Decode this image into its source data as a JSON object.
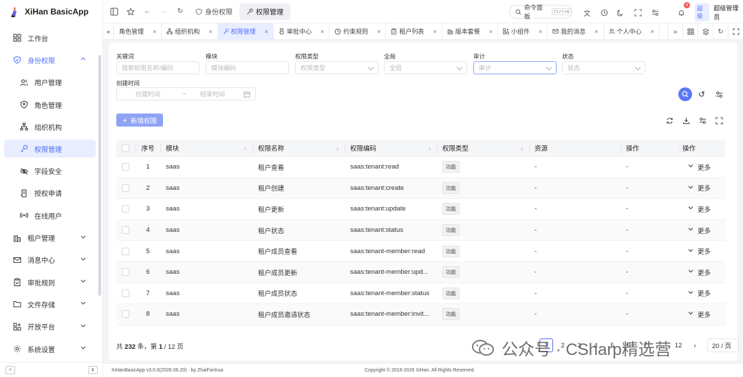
{
  "app": {
    "title": "XiHan BasicApp"
  },
  "sidebar": {
    "items": [
      {
        "label": "工作台",
        "icon": "dashboard-icon"
      },
      {
        "label": "身份权限",
        "icon": "shield-icon",
        "open": true
      },
      {
        "label": "用户管理",
        "icon": "users-icon",
        "sub": true
      },
      {
        "label": "角色管理",
        "icon": "role-shield-icon",
        "sub": true
      },
      {
        "label": "组织机构",
        "icon": "org-tree-icon",
        "sub": true
      },
      {
        "label": "权限管理",
        "icon": "key-icon",
        "sub": true,
        "active": true
      },
      {
        "label": "字段安全",
        "icon": "eye-off-icon",
        "sub": true
      },
      {
        "label": "授权申请",
        "icon": "request-icon",
        "sub": true
      },
      {
        "label": "在线用户",
        "icon": "broadcast-icon",
        "sub": true
      },
      {
        "label": "租户管理",
        "icon": "building-icon"
      },
      {
        "label": "消息中心",
        "icon": "mail-icon"
      },
      {
        "label": "审批规则",
        "icon": "clipboard-check-icon"
      },
      {
        "label": "文件存储",
        "icon": "folder-icon"
      },
      {
        "label": "开放平台",
        "icon": "apps-icon"
      },
      {
        "label": "系统设置",
        "icon": "gear-icon"
      }
    ]
  },
  "header": {
    "breadcrumb": [
      "身份权限",
      "权限管理"
    ],
    "command": "命令面板",
    "shortcut": "Ctrl+K",
    "notify_count": "4",
    "role": "超级",
    "user": "超级管理员"
  },
  "tabs": [
    {
      "label": "角色管理"
    },
    {
      "label": "组织机构"
    },
    {
      "label": "权限管理",
      "active": true
    },
    {
      "label": "审批中心"
    },
    {
      "label": "约束规则"
    },
    {
      "label": "租户列表"
    },
    {
      "label": "版本套餐"
    },
    {
      "label": "小组件"
    },
    {
      "label": "我的消息"
    },
    {
      "label": "个人中心"
    }
  ],
  "filters": {
    "keyword": {
      "label": "关键词",
      "placeholder": "搜索权限名称/编码"
    },
    "module": {
      "label": "模块",
      "placeholder": "模块编码"
    },
    "type": {
      "label": "权限类型",
      "placeholder": "权限类型"
    },
    "global": {
      "label": "全局",
      "placeholder": "全局"
    },
    "audit": {
      "label": "审计",
      "placeholder": "审计"
    },
    "status": {
      "label": "状态",
      "placeholder": "状态"
    },
    "created": {
      "label": "创建时间",
      "start": "创建时间",
      "end": "结束时间"
    }
  },
  "toolbar": {
    "add_label": "新增权限"
  },
  "table": {
    "columns": [
      "序号",
      "模块",
      "权限名称",
      "权限编码",
      "权限类型",
      "资源",
      "操作",
      "操作"
    ],
    "more_label": "更多",
    "rows": [
      {
        "no": "1",
        "module": "saas",
        "name": "租户查看",
        "code": "saas:tenant:read",
        "type": "功能",
        "res": "-",
        "op": "-"
      },
      {
        "no": "2",
        "module": "saas",
        "name": "租户创建",
        "code": "saas:tenant:create",
        "type": "功能",
        "res": "-",
        "op": "-"
      },
      {
        "no": "3",
        "module": "saas",
        "name": "租户更新",
        "code": "saas:tenant:update",
        "type": "功能",
        "res": "-",
        "op": "-"
      },
      {
        "no": "4",
        "module": "saas",
        "name": "租户状态",
        "code": "saas:tenant:status",
        "type": "功能",
        "res": "-",
        "op": "-"
      },
      {
        "no": "5",
        "module": "saas",
        "name": "租户成员查看",
        "code": "saas:tenant-member:read",
        "type": "功能",
        "res": "-",
        "op": "-"
      },
      {
        "no": "6",
        "module": "saas",
        "name": "租户成员更新",
        "code": "saas:tenant-member:upd...",
        "type": "功能",
        "res": "-",
        "op": "-"
      },
      {
        "no": "7",
        "module": "saas",
        "name": "租户成员状态",
        "code": "saas:tenant-member:status",
        "type": "功能",
        "res": "-",
        "op": "-"
      },
      {
        "no": "8",
        "module": "saas",
        "name": "租户成员邀请状态",
        "code": "saas:tenant-member:invit...",
        "type": "功能",
        "res": "-",
        "op": "-"
      }
    ]
  },
  "pager": {
    "prefix": "共",
    "total": "232",
    "mid": "条，第",
    "page": "1",
    "suffix": "/ 12 页",
    "pages": [
      "1",
      "2",
      "3",
      "4",
      "5",
      "6",
      "7",
      "...",
      "12"
    ],
    "size": "20 / 页"
  },
  "watermark": "公众号 · CSharp精选营",
  "footer": {
    "version": "XiHanBasicApp v3.0.0(2026.06.20) · by ZhaiFanhua",
    "copyright": "Copyright © 2016-2026 XiHan. All Rights Reserved."
  }
}
